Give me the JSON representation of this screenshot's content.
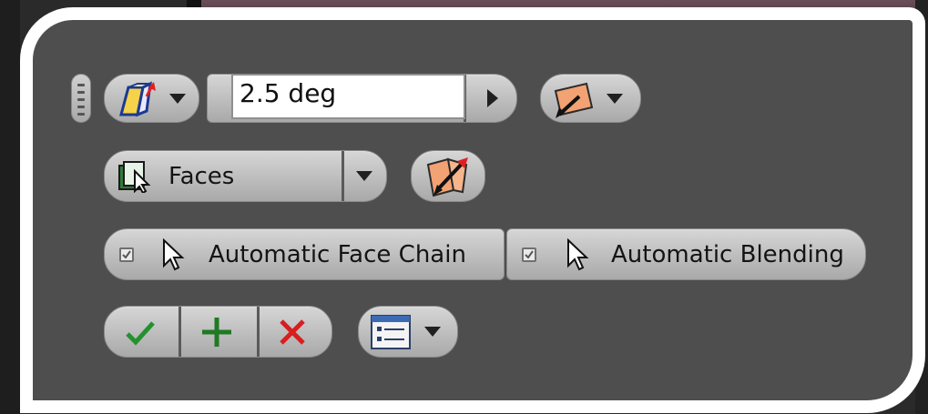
{
  "toolbar": {
    "angle_value": "2.5 deg",
    "faces_label": "Faces",
    "auto_face_chain_label": "Automatic Face Chain",
    "auto_face_chain_checked": true,
    "auto_blending_label": "Automatic Blending",
    "auto_blending_checked": true,
    "icons": {
      "draft_type": "face-draft-icon",
      "pull_direction": "pull-direction-icon",
      "flip_direction": "flip-direction-icon",
      "faces_select": "face-select-icon",
      "ok": "checkmark-icon",
      "apply": "plus-icon",
      "cancel": "close-icon",
      "options": "options-menu-icon"
    }
  }
}
